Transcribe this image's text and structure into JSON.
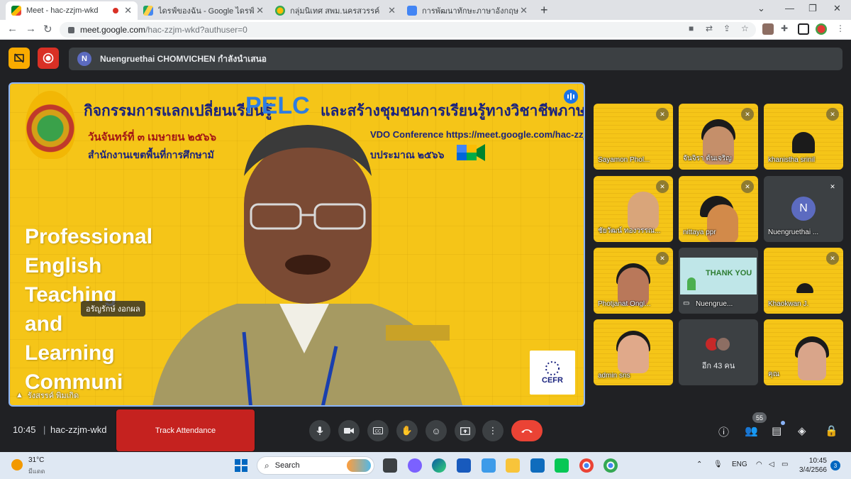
{
  "browser": {
    "tabs": [
      {
        "title": "Meet - hac-zzjm-wkd",
        "active": true,
        "recording": true
      },
      {
        "title": "ไดรฟ์ของฉัน - Google ไดรฟ์",
        "active": false
      },
      {
        "title": "กลุ่มนิเทศ สพม.นครสวรรค์",
        "active": false
      },
      {
        "title": "การพัฒนาทักษะภาษาอังกฤษ English",
        "active": false
      }
    ],
    "url_host": "meet.google.com",
    "url_path": "/hac-zzjm-wkd?authuser=0"
  },
  "meet": {
    "presenter_initial": "N",
    "presenting_text": "Nuengruethai CHOMVICHEN กำลังนำเสนอ",
    "slide": {
      "title_left": "กิจกรรมการแลกเปลี่ยนเรียนรู้",
      "title_brand": "PELC",
      "title_right": "และสร้างชุมชนการเรียนรู้ทางวิชาชีพภาษาอังกฤษ",
      "date_line": "วันจันทร์ที่ ๓ เมษายน ๒๕๖๖",
      "conference_line": "VDO Conference https://meet.google.com/hac-zzjm-wkd",
      "office_line": "สำนักงานเขตพื้นที่การศึกษามั",
      "budget_line": "บประมาณ ๒๕๖๖",
      "big_lines": [
        "Professional",
        "English",
        "Teaching",
        "and",
        "Learning",
        "Communi"
      ],
      "cefr_label": "CEFR"
    },
    "speaker_chip": "อรัญรักษ์ งอกผล",
    "stage_name": "รังสรรค์ พิมเกิด",
    "participants": [
      {
        "name": "Sayamon Phol...",
        "type": "slide"
      },
      {
        "name": "จันจิรา ต้นเจริญ",
        "type": "person"
      },
      {
        "name": "khanistha srinil",
        "type": "slide"
      },
      {
        "name": "ชัยวัฒน์ ทองวรรณ...",
        "type": "slide"
      },
      {
        "name": "nittaya ppr",
        "type": "slide"
      },
      {
        "name": "Nuengruethai ...",
        "type": "avatar",
        "initial": "N"
      },
      {
        "name": "Photjanat Ongl...",
        "type": "slide"
      },
      {
        "name": "Nuengrue...",
        "type": "thankyou",
        "thank_text": "THANK YOU"
      },
      {
        "name": "Khaokwan J.",
        "type": "slide"
      },
      {
        "name": "admin sns",
        "type": "slide"
      },
      {
        "name": "",
        "type": "more",
        "more_text": "อีก 43 คน"
      },
      {
        "name": "คุณ",
        "type": "slide"
      }
    ],
    "bottom": {
      "time": "10:45",
      "meeting_code": "hac-zzjm-wkd",
      "track_button": "Track Attendance",
      "people_count": "55"
    }
  },
  "taskbar": {
    "temp": "31°C",
    "condition": "มีแดด",
    "search_label": "Search",
    "lang": "ENG",
    "time": "10:45",
    "date": "3/4/2566",
    "notifications": "3"
  },
  "colors": {
    "accent": "#8ab4f8",
    "end_call": "#ea4335",
    "track_button": "#c5221f",
    "slide_yellow": "#f5c518"
  }
}
